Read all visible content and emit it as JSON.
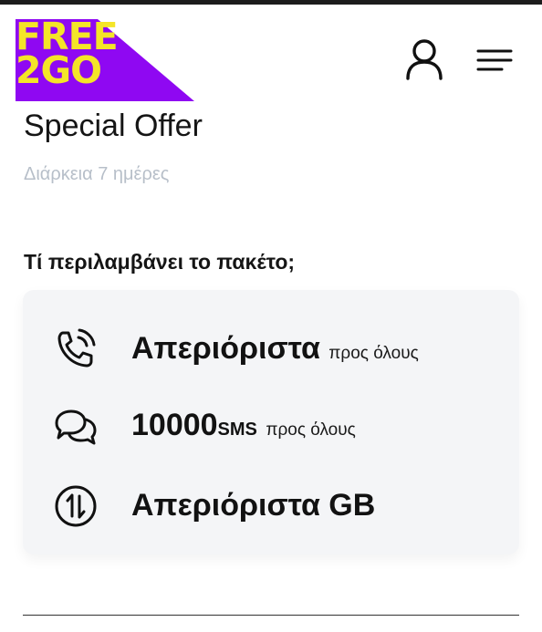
{
  "logo": {
    "line1": "FREE",
    "line2": "2GO",
    "brand_yellow": "#f4e528",
    "brand_purple": "#8f08f2"
  },
  "header": {
    "account_icon": "user-icon",
    "menu_icon": "hamburger-menu-icon"
  },
  "offer": {
    "title": "Special Offer",
    "duration": "Διάρκεια 7 ημέρες"
  },
  "package": {
    "heading": "Τί περιλαμβάνει το πακέτο;",
    "features": [
      {
        "icon": "phone-call-icon",
        "value": "Απεριόριστα",
        "unit": "",
        "note": "προς όλους"
      },
      {
        "icon": "chat-bubbles-icon",
        "value": "10000",
        "unit": "SMS",
        "note": "προς όλους"
      },
      {
        "icon": "data-transfer-icon",
        "value": "Απεριόριστα GB",
        "unit": "",
        "note": ""
      }
    ]
  }
}
